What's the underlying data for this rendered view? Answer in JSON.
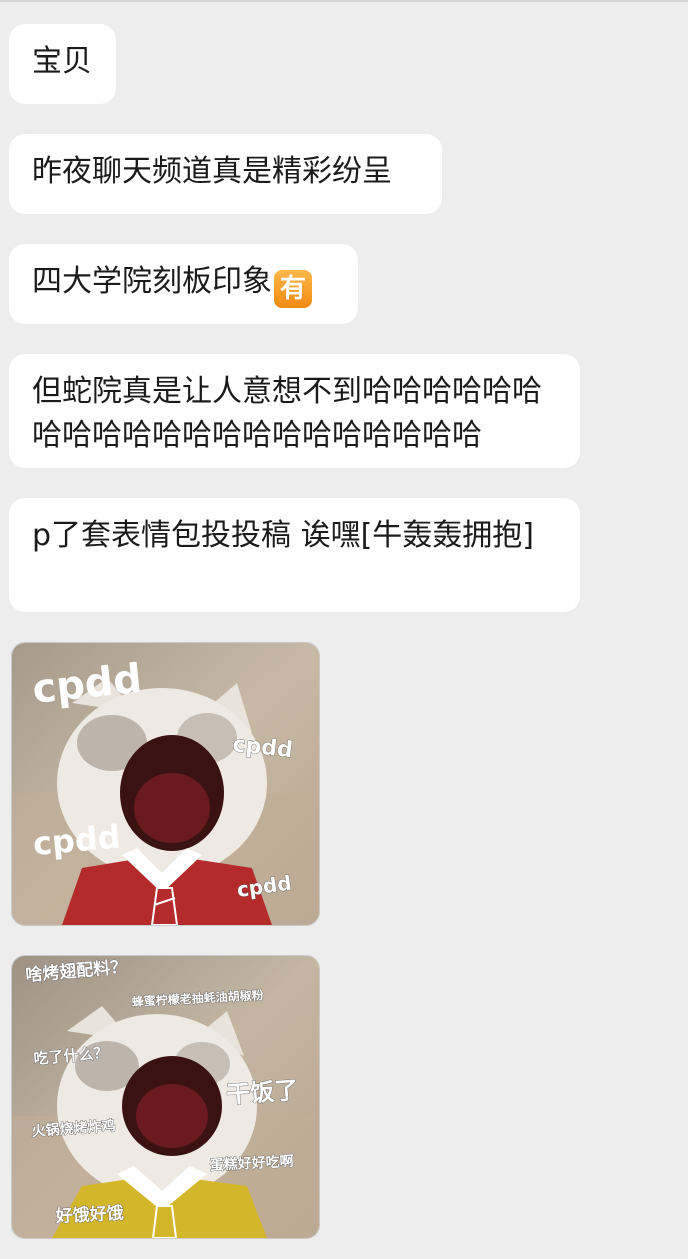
{
  "messages": [
    {
      "text": "宝贝"
    },
    {
      "text": "昨夜聊天频道真是精彩纷呈"
    },
    {
      "text": "四大学院刻板印象",
      "emoji": "有"
    },
    {
      "text": "但蛇院真是让人意想不到哈哈哈哈哈哈哈哈哈哈哈哈哈哈哈哈哈哈哈哈哈"
    },
    {
      "text": "p了套表情包投投稿 诶嘿[牛轰轰拥抱]"
    }
  ],
  "sticker1": {
    "captions": [
      "cpdd",
      "cpdd",
      "cpdd",
      "cpdd"
    ],
    "tie_color": "#b52b2b"
  },
  "sticker2": {
    "captions": [
      "啥烤翅配料？",
      "蜂蜜柠檬老抽蚝油胡椒粉",
      "吃了什么？",
      "干饭了",
      "火锅烧烤炸鸡",
      "蛋糕好好吃啊",
      "好饿好饿"
    ],
    "tie_color": "#d4b62a"
  }
}
